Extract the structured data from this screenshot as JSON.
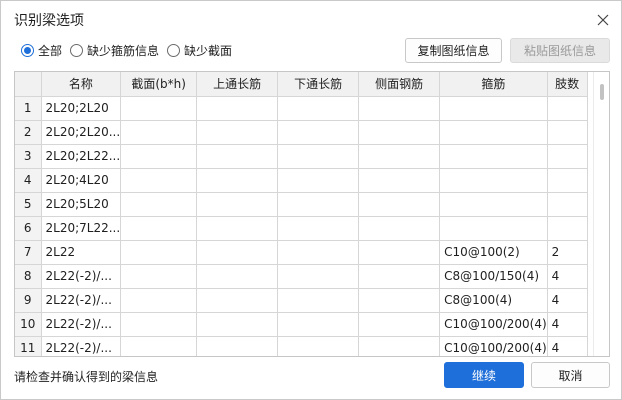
{
  "dialog": {
    "title": "识别梁选项"
  },
  "filters": [
    {
      "label": "全部",
      "checked": true
    },
    {
      "label": "缺少箍筋信息",
      "checked": false
    },
    {
      "label": "缺少截面",
      "checked": false
    }
  ],
  "buttons": {
    "copy": "复制图纸信息",
    "paste": "粘贴图纸信息",
    "continue": "继续",
    "cancel": "取消"
  },
  "table": {
    "headers": [
      "名称",
      "截面(b*h)",
      "上通长筋",
      "下通长筋",
      "侧面钢筋",
      "箍筋",
      "肢数"
    ],
    "rows": [
      {
        "num": "1",
        "name": "2L20;2L20",
        "section": "",
        "top": "",
        "bottom": "",
        "side": "",
        "stirrup": "",
        "legs": ""
      },
      {
        "num": "2",
        "name": "2L20;2L20...",
        "section": "",
        "top": "",
        "bottom": "",
        "side": "",
        "stirrup": "",
        "legs": ""
      },
      {
        "num": "3",
        "name": "2L20;2L22...",
        "section": "",
        "top": "",
        "bottom": "",
        "side": "",
        "stirrup": "",
        "legs": ""
      },
      {
        "num": "4",
        "name": "2L20;4L20",
        "section": "",
        "top": "",
        "bottom": "",
        "side": "",
        "stirrup": "",
        "legs": ""
      },
      {
        "num": "5",
        "name": "2L20;5L20",
        "section": "",
        "top": "",
        "bottom": "",
        "side": "",
        "stirrup": "",
        "legs": ""
      },
      {
        "num": "6",
        "name": "2L20;7L22...",
        "section": "",
        "top": "",
        "bottom": "",
        "side": "",
        "stirrup": "",
        "legs": ""
      },
      {
        "num": "7",
        "name": "2L22",
        "section": "",
        "top": "",
        "bottom": "",
        "side": "",
        "stirrup": "C10@100(2)",
        "legs": "2"
      },
      {
        "num": "8",
        "name": "2L22(-2)/...",
        "section": "",
        "top": "",
        "bottom": "",
        "side": "",
        "stirrup": "C8@100/150(4)",
        "legs": "4"
      },
      {
        "num": "9",
        "name": "2L22(-2)/...",
        "section": "",
        "top": "",
        "bottom": "",
        "side": "",
        "stirrup": "C8@100(4)",
        "legs": "4"
      },
      {
        "num": "10",
        "name": "2L22(-2)/...",
        "section": "",
        "top": "",
        "bottom": "",
        "side": "",
        "stirrup": "C10@100/200(4)",
        "legs": "4"
      },
      {
        "num": "11",
        "name": "2L22(-2)/...",
        "section": "",
        "top": "",
        "bottom": "",
        "side": "",
        "stirrup": "C10@100/200(4)",
        "legs": "4"
      }
    ]
  },
  "footer": {
    "hint": "请检查并确认得到的梁信息"
  },
  "colors": {
    "accent": "#1e6fd9",
    "header_bg": "#f1f1f1",
    "grid_line": "#d6d6d6"
  }
}
